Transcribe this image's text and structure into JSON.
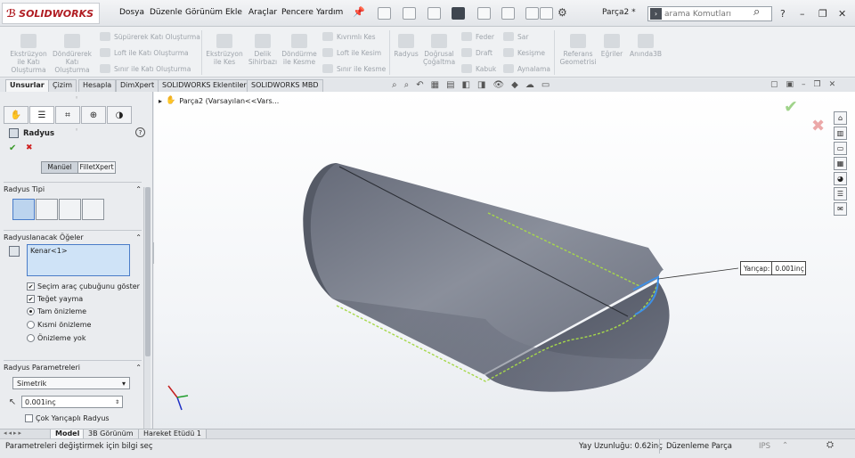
{
  "app": {
    "logo": "SOLIDWORKS",
    "doc_title": "Parça2 *"
  },
  "menu": [
    "Dosya",
    "Düzenle",
    "Görünüm",
    "Ekle",
    "Araçlar",
    "Pencere",
    "Yardım"
  ],
  "search": {
    "placeholder": "arama Komutları"
  },
  "window_controls": {
    "help": "?",
    "minimize": "–",
    "restore": "❐",
    "close": "✕"
  },
  "ribbon": {
    "extrude_boss": "Ekstrüzyon ile Katı Oluşturma",
    "revolve_boss": "Döndürerek Katı Oluşturma",
    "sweep_boss": "Süpürerek Katı Oluşturma",
    "loft_boss": "Loft ile Katı Oluşturma",
    "boundary_boss": "Sınır ile Katı Oluşturma",
    "extrude_cut": "Ekstrüzyon ile Kes",
    "hole_wizard": "Delik Sihirbazı",
    "revolve_cut": "Döndürme ile Kesme",
    "swept_cut": "Kıvrımlı Kes",
    "lofted_cut": "Loft ile Kesim",
    "boundary_cut": "Sınır ile Kesme",
    "fillet": "Radyus",
    "linear_pattern": "Doğrusal Çoğaltma",
    "rib": "Feder",
    "wrap": "Sar",
    "draft": "Draft",
    "intersect": "Kesişme",
    "shell": "Kabuk",
    "mirror": "Aynalama",
    "ref_geometry": "Referans Geometrisi",
    "curves": "Eğriler",
    "instant3d": "Anında3B"
  },
  "tabs": [
    "Unsurlar",
    "Çizim",
    "Hesapla",
    "DimXpert",
    "SOLIDWORKS Eklentileri",
    "SOLIDWORKS MBD"
  ],
  "feature_tree": {
    "root": "Parça2  (Varsayılan<<Vars..."
  },
  "property_manager": {
    "title": "Radyus",
    "help_icon": "?",
    "ok": "✔",
    "cancel": "✖",
    "mode_manual": "Manüel",
    "mode_filletxpert": "FilletXpert",
    "fillet_type_title": "Radyus Tipi",
    "items_title": "Radyuslanacak Öğeler",
    "items_list": [
      "Kenar<1>"
    ],
    "show_selection_toolbar": "Seçim araç çubuğunu göster",
    "tangent_propagation": "Teğet yayma",
    "full_preview": "Tam önizleme",
    "partial_preview": "Kısmi önizleme",
    "no_preview": "Önizleme yok",
    "params_title": "Radyus Parametreleri",
    "profile_option": "Simetrik",
    "radius_value": "0.001inç",
    "multi_radius": "Çok Yarıçaplı Radyus"
  },
  "callout": {
    "label": "Yarıçap:",
    "value": "0.001inç"
  },
  "bottom_tabs": [
    "Model",
    "3B Görünüm",
    "Hareket Etüdü 1"
  ],
  "status": {
    "message": "Parametreleri değiştirmek için bilgi seç",
    "arc_length": "Yay Uzunluğu: 0.62inç",
    "mode": "Düzenleme Parça",
    "units": "IPS"
  },
  "colors": {
    "accent_red": "#b01c22",
    "selection_green": "#a6d84a",
    "selection_blue": "#3e8fe6",
    "part_gray": "#6e7380",
    "ok_green": "#3b9a2a",
    "cancel_red": "#d02020"
  }
}
